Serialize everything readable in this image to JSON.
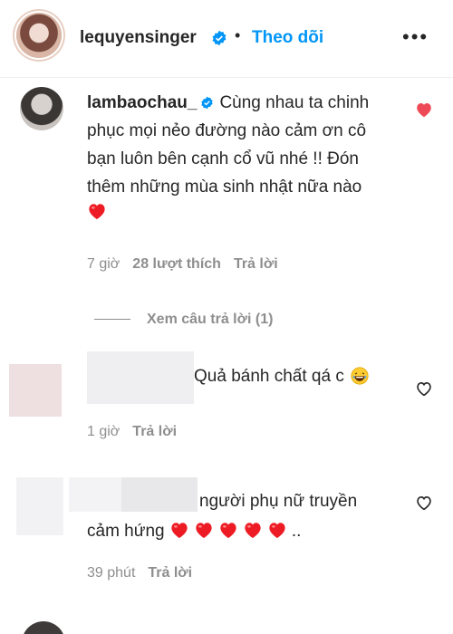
{
  "header": {
    "username": "lequyensinger",
    "separator": "•",
    "follow_label": "Theo dõi",
    "more_label": "•••"
  },
  "comment1": {
    "username": "lambaochau_",
    "text": "Cùng nhau ta chinh phục mọi nẻo đường nào cảm ơn cô bạn luôn bên cạnh cổ vũ nhé !! Đón thêm những mùa sinh nhật nữa nào",
    "emoji": "red-heart",
    "time": "7 giờ",
    "likes": "28 lượt thích",
    "reply_label": "Trả lời",
    "view_replies": "Xem câu trả lời (1)",
    "liked": true
  },
  "comment2": {
    "text": "Quả bánh chất qá c",
    "emoji": "laughing-face",
    "time": "1 giờ",
    "reply_label": "Trả lời"
  },
  "comment3": {
    "text_line1": "người phụ nữ truyền",
    "text_line2": "cảm hứng",
    "suffix": "..",
    "hearts_count": 5,
    "time": "39 phút",
    "reply_label": "Trả lời"
  },
  "colors": {
    "accent": "#0095f6",
    "heart": "#ed4956",
    "muted": "#8e8e8e",
    "text": "#262626"
  }
}
